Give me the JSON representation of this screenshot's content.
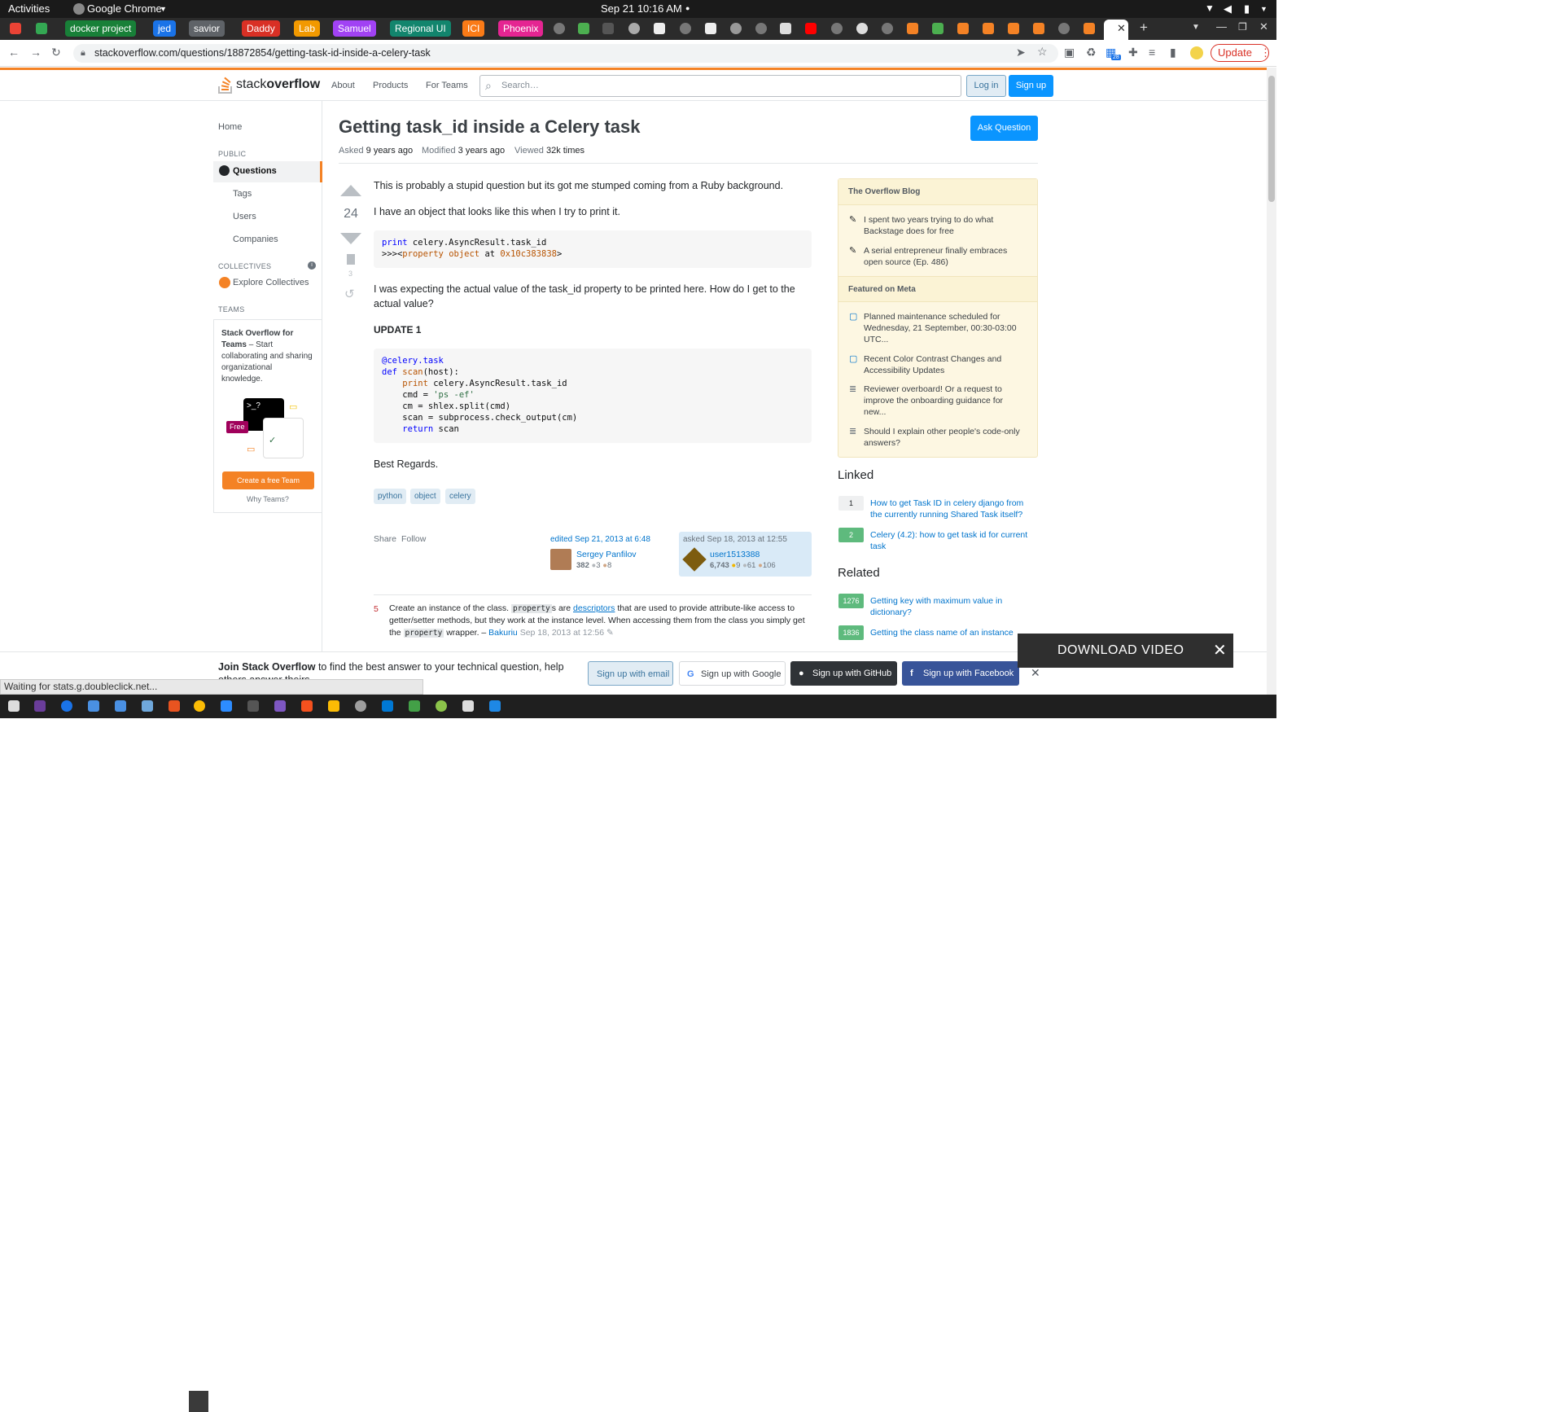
{
  "os": {
    "activities": "Activities",
    "app": "Google Chrome",
    "clock": "Sep 21  10:16 AM"
  },
  "tabs": {
    "labeled": [
      {
        "label": "docker project",
        "color": "#188038"
      },
      {
        "label": "jed",
        "color": "#1a73e8"
      },
      {
        "label": "savior",
        "color": "#5f6368"
      },
      {
        "label": "Daddy",
        "color": "#d93025"
      },
      {
        "label": "Lab",
        "color": "#f29900"
      },
      {
        "label": "Samuel",
        "color": "#a142f4"
      },
      {
        "label": "Regional UI",
        "color": "#12856d"
      },
      {
        "label": "ICI",
        "color": "#fa7b17"
      },
      {
        "label": "Phoenix",
        "color": "#e52592"
      }
    ],
    "new_tab": "+"
  },
  "address": {
    "url": "stackoverflow.com/questions/18872854/getting-task-id-inside-a-celery-task",
    "update_label": "Update",
    "ext_badge": "28"
  },
  "so_header": {
    "brand": "stackoverflow",
    "brand_prefix": "stack",
    "brand_suffix": "overflow",
    "about": "About",
    "products": "Products",
    "for_teams": "For Teams",
    "search_placeholder": "Search…",
    "login": "Log in",
    "signup": "Sign up"
  },
  "leftnav": {
    "home": "Home",
    "public": "PUBLIC",
    "questions": "Questions",
    "tags": "Tags",
    "users": "Users",
    "companies": "Companies",
    "collectives": "COLLECTIVES",
    "explore": "Explore Collectives",
    "teams": "TEAMS",
    "team_title": "Stack Overflow for Teams",
    "team_text": " – Start collaborating and sharing organizational knowledge.",
    "free": "Free",
    "create_team": "Create a free Team",
    "why_teams": "Why Teams?"
  },
  "question": {
    "title": "Getting task_id inside a Celery task",
    "asked_label": "Asked",
    "asked": "9 years ago",
    "modified_label": "Modified",
    "modified": "3 years ago",
    "viewed_label": "Viewed",
    "viewed": "32k times",
    "ask_button": "Ask Question",
    "votes": "24",
    "bookmarks": "3",
    "p1": "This is probably a stupid question but its got me stumped coming from a Ruby background.",
    "p2": "I have an object that looks like this when I try to print it.",
    "p3": "I was expecting the actual value of the task_id property to be printed here. How do I get to the actual value?",
    "update": "UPDATE 1",
    "regards": "Best Regards.",
    "tags": [
      "python",
      "object",
      "celery"
    ],
    "share": "Share",
    "follow": "Follow",
    "edited": "edited Sep 21, 2013 at 6:48",
    "editor": "Sergey Panfilov",
    "editor_rep": "382",
    "editor_silver": "3",
    "editor_bronze": "8",
    "asked_full": "asked Sep 18, 2013 at 12:55",
    "asker": "user1513388",
    "asker_rep": "6,743",
    "asker_gold": "9",
    "asker_silver": "61",
    "asker_bronze": "106",
    "comment_score": "5",
    "comment_text": "Create an instance of the class.",
    "comment_code1": "property",
    "comment_mid": "s are",
    "comment_link": "descriptors",
    "comment_rest": "that are used to provide attribute-like access to getter/setter methods, but they work at the instance level. When accessing them from the class you simply get the",
    "comment_code2": "property",
    "comment_end": "wrapper. –",
    "comment_user": "Bakuriu",
    "comment_date": "Sep 18, 2013 at 12:56"
  },
  "code1": {
    "l1_kw": "print",
    "l1_rest": " celery.AsyncResult.task_id",
    "l2_pre": ">>><",
    "l2_kw": "property object",
    "l2_mid": " at ",
    "l2_num": "0x10c383838",
    "l2_end": ">"
  },
  "code2": {
    "decorator": "@celery.task",
    "def": "def",
    "fname": "scan",
    "args": "(host):",
    "print": "print",
    "print_rest": " celery.AsyncResult.task_id",
    "cmd": "cmd = ",
    "cmd_str": "'ps -ef'",
    "cm": "cm = shlex.split(cmd)",
    "scan": "scan = subprocess.check_output(cm)",
    "ret": "return",
    "ret_rest": " scan"
  },
  "blog": {
    "header": "The Overflow Blog",
    "items": [
      "I spent two years trying to do what Backstage does for free",
      "A serial entrepreneur finally embraces open source (Ep. 486)"
    ],
    "meta_header": "Featured on Meta",
    "meta_items": [
      "Planned maintenance scheduled for Wednesday, 21 September, 00:30-03:00 UTC...",
      "Recent Color Contrast Changes and Accessibility Updates",
      "Reviewer overboard! Or a request to improve the onboarding guidance for new...",
      "Should I explain other people's code-only answers?"
    ]
  },
  "linked": {
    "header": "Linked",
    "items": [
      {
        "count": "1",
        "title": "How to get Task ID in celery django from the currently running Shared Task itself?"
      },
      {
        "count": "2",
        "title": "Celery (4.2): how to get task id for current task"
      }
    ]
  },
  "related": {
    "header": "Related",
    "items": [
      {
        "count": "1276",
        "title": "Getting key with maximum value in dictionary?"
      },
      {
        "count": "1836",
        "title": "Getting the class name of an instance"
      }
    ]
  },
  "join": {
    "bold": "Join Stack Overflow",
    "text": " to find the best answer to your technical question, help others answer theirs.",
    "email": "Sign up with email",
    "google": "Sign up with Google",
    "github": "Sign up with GitHub",
    "facebook": "Sign up with Facebook"
  },
  "download": {
    "label": "DOWNLOAD VIDEO"
  },
  "status": "Waiting for stats.g.doubleclick.net...",
  "colors": {
    "accent": "#f48225",
    "blue": "#0a95ff",
    "link": "#0074cc"
  }
}
